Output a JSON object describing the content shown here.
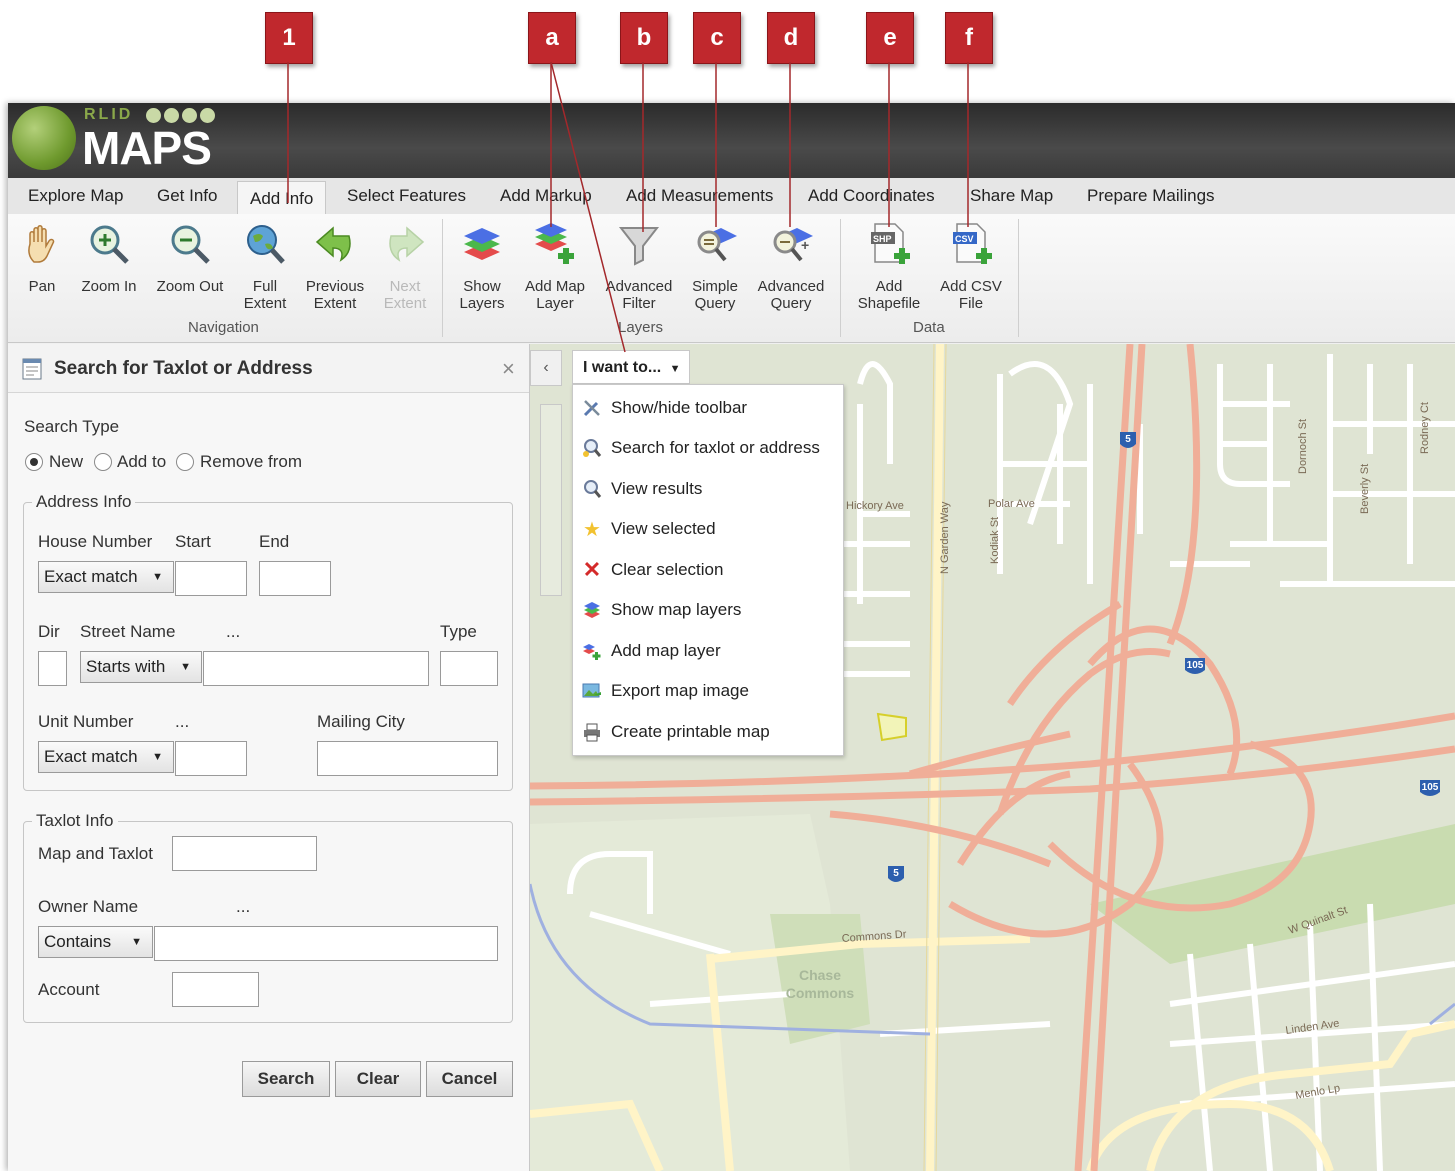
{
  "callouts": [
    "1",
    "a",
    "b",
    "c",
    "d",
    "e",
    "f"
  ],
  "app": {
    "logo_small": "RLID",
    "logo_big": "MAPS"
  },
  "tabs": [
    "Explore Map",
    "Get Info",
    "Add Info",
    "Select Features",
    "Add Markup",
    "Add Measurements",
    "Add Coordinates",
    "Share Map",
    "Prepare Mailings"
  ],
  "active_tab": "Add Info",
  "ribbon": {
    "navigation": {
      "label": "Navigation",
      "buttons": [
        {
          "line1": "Pan",
          "line2": ""
        },
        {
          "line1": "Zoom In",
          "line2": ""
        },
        {
          "line1": "Zoom Out",
          "line2": ""
        },
        {
          "line1": "Full",
          "line2": "Extent"
        },
        {
          "line1": "Previous",
          "line2": "Extent"
        },
        {
          "line1": "Next",
          "line2": "Extent"
        }
      ]
    },
    "layers": {
      "label": "Layers",
      "buttons": [
        {
          "line1": "Show",
          "line2": "Layers"
        },
        {
          "line1": "Add Map",
          "line2": "Layer"
        },
        {
          "line1": "Advanced",
          "line2": "Filter"
        },
        {
          "line1": "Simple",
          "line2": "Query"
        },
        {
          "line1": "Advanced",
          "line2": "Query"
        }
      ]
    },
    "data": {
      "label": "Data",
      "buttons": [
        {
          "line1": "Add",
          "line2": "Shapefile",
          "tag": "SHP"
        },
        {
          "line1": "Add CSV",
          "line2": "File",
          "tag": "CSV"
        }
      ]
    }
  },
  "panel": {
    "title": "Search for Taxlot or Address",
    "search_type_label": "Search Type",
    "search_types": [
      "New",
      "Add to",
      "Remove from"
    ],
    "address_info": {
      "legend": "Address Info",
      "house_number": "House Number",
      "start": "Start",
      "end": "End",
      "house_match": "Exact match",
      "dir": "Dir",
      "street_name": "Street Name",
      "street_ellipsis": "...",
      "type": "Type",
      "street_match": "Starts with",
      "unit_number": "Unit Number",
      "unit_ellipsis": "...",
      "mailing_city": "Mailing City",
      "unit_match": "Exact match"
    },
    "taxlot_info": {
      "legend": "Taxlot Info",
      "map_taxlot": "Map and Taxlot",
      "owner_name": "Owner Name",
      "owner_ellipsis": "...",
      "owner_match": "Contains",
      "account": "Account"
    },
    "buttons": {
      "search": "Search",
      "clear": "Clear",
      "cancel": "Cancel"
    }
  },
  "map": {
    "i_want_to": "I want to...",
    "menu": [
      "Show/hide toolbar",
      "Search for taxlot or address",
      "View results",
      "View selected",
      "Clear selection",
      "Show map layers",
      "Add map layer",
      "Export map image",
      "Create printable map"
    ],
    "labels": {
      "chase_commons_1": "Chase",
      "chase_commons_2": "Commons",
      "commons_dr": "Commons Dr",
      "w_quinalt": "W Quinalt St",
      "linden": "Linden Ave",
      "menlo": "Menlo Lp",
      "n_garden": "N Garden Way",
      "kodiak": "Kodiak St",
      "polar": "Polar Ave",
      "hickory": "Hickory Ave",
      "dornoch": "Dornoch St",
      "beverly": "Beverly St",
      "rodney": "Rodney Ct",
      "i5": "5",
      "hwy105": "105"
    }
  },
  "colors": {
    "callout": "#c0282d",
    "highway": "#f0ae98",
    "road": "#ffffff",
    "road_yellow": "#fff4c7",
    "map_bg": "#dfe4d3",
    "water": "#9fb0e0"
  }
}
